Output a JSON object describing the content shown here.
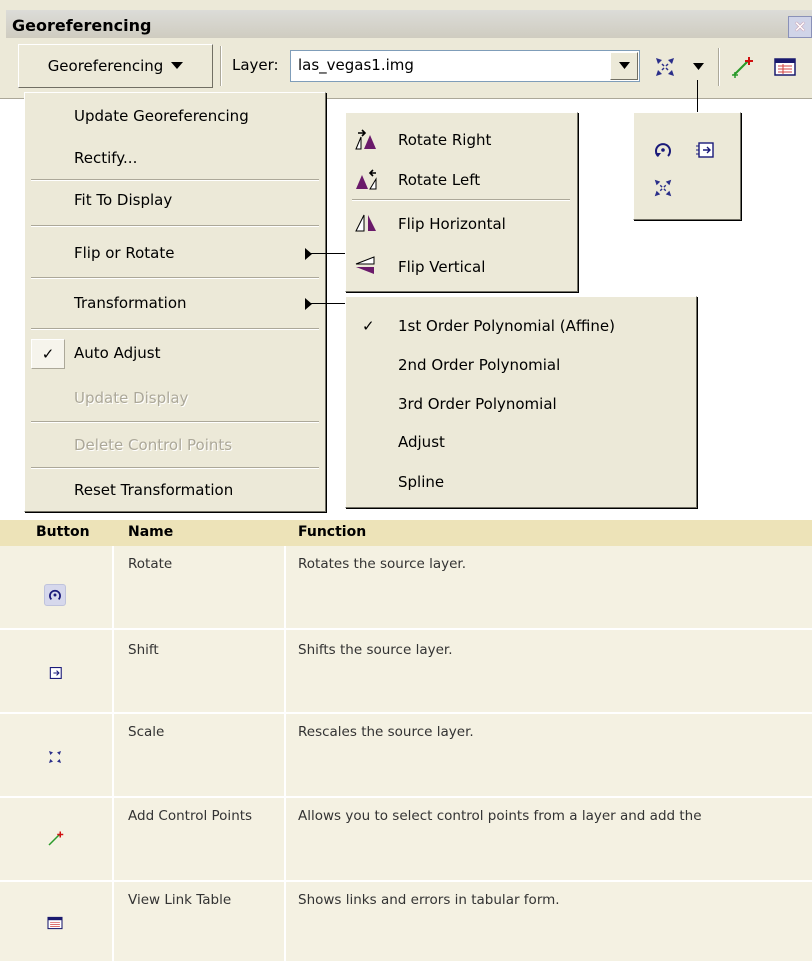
{
  "toolbar": {
    "title": "Georeferencing",
    "close_glyph": "✕",
    "menu_button_label": "Georeferencing",
    "layer_label": "Layer:",
    "layer_value": "las_vegas1.img",
    "icons": [
      "scale-icon",
      "dropdown-arrow-icon",
      "add-control-points-icon",
      "view-link-table-icon"
    ]
  },
  "georef_menu": {
    "items": [
      {
        "label": "Update Georeferencing",
        "enabled": true
      },
      {
        "label": "Rectify...",
        "enabled": true
      },
      {
        "label": "Fit To Display",
        "enabled": true
      },
      {
        "label": "Flip or Rotate",
        "enabled": true,
        "submenu": true
      },
      {
        "label": "Transformation",
        "enabled": true,
        "submenu": true
      },
      {
        "label": "Auto Adjust",
        "enabled": true,
        "checked": true
      },
      {
        "label": "Update Display",
        "enabled": false
      },
      {
        "label": "Delete Control Points",
        "enabled": false
      },
      {
        "label": "Reset Transformation",
        "enabled": true
      }
    ]
  },
  "flip_rotate_menu": {
    "items": [
      {
        "label": "Rotate Right",
        "icon": "rotate-right-icon"
      },
      {
        "label": "Rotate Left",
        "icon": "rotate-left-icon"
      },
      {
        "label": "Flip Horizontal",
        "icon": "flip-horizontal-icon"
      },
      {
        "label": "Flip Vertical",
        "icon": "flip-vertical-icon"
      }
    ]
  },
  "transformation_menu": {
    "check_glyph": "✓",
    "items": [
      {
        "label": "1st Order Polynomial (Affine)",
        "checked": true
      },
      {
        "label": "2nd Order Polynomial",
        "checked": false
      },
      {
        "label": "3rd Order Polynomial",
        "checked": false
      },
      {
        "label": "Adjust",
        "checked": false
      },
      {
        "label": "Spline",
        "checked": false
      }
    ]
  },
  "floating_toolbar": {
    "icons": [
      "rotate-icon",
      "shift-icon",
      "scale-icon"
    ]
  },
  "table": {
    "headers": [
      "Button",
      "Name",
      "Function"
    ],
    "rows": [
      {
        "icon": "rotate-icon",
        "name": "Rotate",
        "function": "Rotates the source layer."
      },
      {
        "icon": "shift-icon",
        "name": "Shift",
        "function": "Shifts the source layer."
      },
      {
        "icon": "scale-icon",
        "name": "Scale",
        "function": "Rescales the source layer."
      },
      {
        "icon": "add-control-points-icon",
        "name": "Add Control Points",
        "function": "Allows you to select control points from a layer and add the"
      },
      {
        "icon": "view-link-table-icon",
        "name": "View Link Table",
        "function": "Shows links and errors in tabular form."
      }
    ]
  },
  "colors": {
    "menu_bg": "#ece9d8",
    "table_header_bg": "#ede3b8",
    "table_row_bg": "#f4f1e2",
    "disabled_text": "#aca899"
  }
}
